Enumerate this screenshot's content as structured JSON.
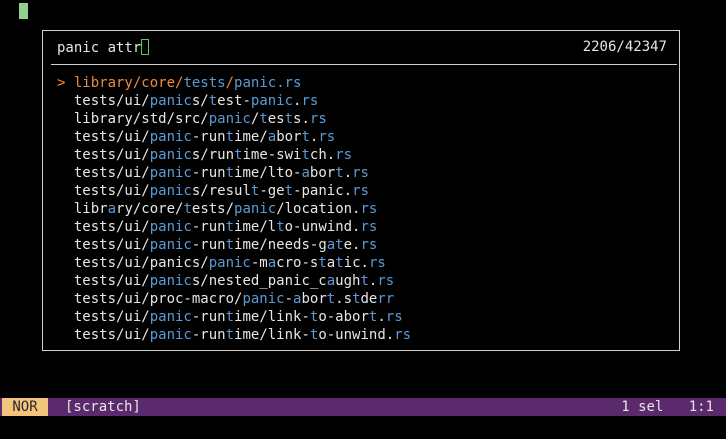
{
  "picker": {
    "query": "panic attr",
    "count": "2206/42347",
    "selected_marker": ">",
    "results": [
      {
        "text": "library/core/tests/panic.rs",
        "selected": true,
        "segments": [
          [
            "library/core/",
            0
          ],
          [
            "tests",
            1
          ],
          [
            "/",
            0
          ],
          [
            "panic",
            1
          ],
          [
            ".rs",
            1
          ]
        ]
      },
      {
        "text": "tests/ui/panics/test-panic.rs",
        "segments": [
          [
            "tests/ui/",
            0
          ],
          [
            "panic",
            1
          ],
          [
            "s/",
            0
          ],
          [
            "t",
            1
          ],
          [
            "est-",
            0
          ],
          [
            "panic",
            1
          ],
          [
            ".",
            0
          ],
          [
            "rs",
            1
          ]
        ]
      },
      {
        "text": "library/std/src/panic/tests.rs",
        "segments": [
          [
            "library/std/src/",
            0
          ],
          [
            "panic",
            1
          ],
          [
            "/",
            0
          ],
          [
            "t",
            1
          ],
          [
            "es",
            0
          ],
          [
            "t",
            1
          ],
          [
            "s.",
            0
          ],
          [
            "rs",
            1
          ]
        ]
      },
      {
        "text": "tests/ui/panic-runtime/abort.rs",
        "segments": [
          [
            "tests/ui/",
            0
          ],
          [
            "panic",
            1
          ],
          [
            "-run",
            0
          ],
          [
            "t",
            1
          ],
          [
            "ime/",
            0
          ],
          [
            "a",
            1
          ],
          [
            "bor",
            0
          ],
          [
            "t",
            1
          ],
          [
            ".",
            0
          ],
          [
            "rs",
            1
          ]
        ]
      },
      {
        "text": "tests/ui/panics/runtime-switch.rs",
        "segments": [
          [
            "tests/ui/",
            0
          ],
          [
            "panic",
            1
          ],
          [
            "s/run",
            0
          ],
          [
            "t",
            1
          ],
          [
            "ime-swi",
            0
          ],
          [
            "t",
            1
          ],
          [
            "ch.",
            0
          ],
          [
            "rs",
            1
          ]
        ]
      },
      {
        "text": "tests/ui/panic-runtime/lto-abort.rs",
        "segments": [
          [
            "tests/ui/",
            0
          ],
          [
            "panic",
            1
          ],
          [
            "-run",
            0
          ],
          [
            "t",
            1
          ],
          [
            "ime/lto-",
            0
          ],
          [
            "a",
            1
          ],
          [
            "bor",
            0
          ],
          [
            "t",
            1
          ],
          [
            ".",
            0
          ],
          [
            "rs",
            1
          ]
        ]
      },
      {
        "text": "tests/ui/panics/result-get-panic.rs",
        "segments": [
          [
            "tests/ui/",
            0
          ],
          [
            "panic",
            1
          ],
          [
            "s/resul",
            0
          ],
          [
            "t",
            1
          ],
          [
            "-ge",
            0
          ],
          [
            "t",
            1
          ],
          [
            "-panic.",
            0
          ],
          [
            "rs",
            1
          ]
        ]
      },
      {
        "text": "library/core/tests/panic/location.rs",
        "segments": [
          [
            "libr",
            0
          ],
          [
            "a",
            1
          ],
          [
            "ry/core/",
            0
          ],
          [
            "t",
            1
          ],
          [
            "ests/",
            0
          ],
          [
            "panic",
            1
          ],
          [
            "/location.",
            0
          ],
          [
            "rs",
            1
          ]
        ]
      },
      {
        "text": "tests/ui/panic-runtime/lto-unwind.rs",
        "segments": [
          [
            "tests/ui/",
            0
          ],
          [
            "panic",
            1
          ],
          [
            "-run",
            0
          ],
          [
            "t",
            1
          ],
          [
            "ime/l",
            0
          ],
          [
            "t",
            1
          ],
          [
            "o-unwind.",
            0
          ],
          [
            "rs",
            1
          ]
        ]
      },
      {
        "text": "tests/ui/panic-runtime/needs-gate.rs",
        "segments": [
          [
            "tests/ui/",
            0
          ],
          [
            "panic",
            1
          ],
          [
            "-run",
            0
          ],
          [
            "t",
            1
          ],
          [
            "ime/needs-g",
            0
          ],
          [
            "at",
            1
          ],
          [
            "e.",
            0
          ],
          [
            "rs",
            1
          ]
        ]
      },
      {
        "text": "tests/ui/panics/panic-macro-static.rs",
        "segments": [
          [
            "tests/ui/panics/",
            0
          ],
          [
            "panic",
            1
          ],
          [
            "-m",
            0
          ],
          [
            "a",
            1
          ],
          [
            "cro-s",
            0
          ],
          [
            "t",
            1
          ],
          [
            "a",
            0
          ],
          [
            "t",
            1
          ],
          [
            "ic.",
            0
          ],
          [
            "rs",
            1
          ]
        ]
      },
      {
        "text": "tests/ui/panics/nested_panic_caught.rs",
        "segments": [
          [
            "tests/ui/",
            0
          ],
          [
            "panic",
            1
          ],
          [
            "s/nested_panic_c",
            0
          ],
          [
            "a",
            1
          ],
          [
            "ugh",
            0
          ],
          [
            "t",
            1
          ],
          [
            ".",
            0
          ],
          [
            "rs",
            1
          ]
        ]
      },
      {
        "text": "tests/ui/proc-macro/panic-abort.stderr",
        "segments": [
          [
            "tests/ui/proc-macro/",
            0
          ],
          [
            "panic",
            1
          ],
          [
            "-",
            0
          ],
          [
            "a",
            1
          ],
          [
            "bor",
            0
          ],
          [
            "t",
            1
          ],
          [
            ".s",
            0
          ],
          [
            "t",
            1
          ],
          [
            "de",
            0
          ],
          [
            "rr",
            1
          ]
        ]
      },
      {
        "text": "tests/ui/panic-runtime/link-to-abort.rs",
        "segments": [
          [
            "tests/ui/",
            0
          ],
          [
            "panic",
            1
          ],
          [
            "-run",
            0
          ],
          [
            "t",
            1
          ],
          [
            "ime/link-",
            0
          ],
          [
            "t",
            1
          ],
          [
            "o-abor",
            0
          ],
          [
            "t",
            1
          ],
          [
            ".",
            0
          ],
          [
            "rs",
            1
          ]
        ]
      },
      {
        "text": "tests/ui/panic-runtime/link-to-unwind.rs",
        "segments": [
          [
            "tests/ui/",
            0
          ],
          [
            "panic",
            1
          ],
          [
            "-run",
            0
          ],
          [
            "t",
            1
          ],
          [
            "ime/link-",
            0
          ],
          [
            "t",
            1
          ],
          [
            "o-unwind.",
            0
          ],
          [
            "rs",
            1
          ]
        ]
      }
    ]
  },
  "statusbar": {
    "mode": "NOR",
    "buffer": "[scratch]",
    "selections": "1 sel",
    "position": "1:1"
  },
  "colors": {
    "background": "#000000",
    "highlight": "#5a9bd5",
    "selected": "#f08b3a",
    "statusbar": "#5a2a6c",
    "mode_badge": "#f3c47d"
  }
}
